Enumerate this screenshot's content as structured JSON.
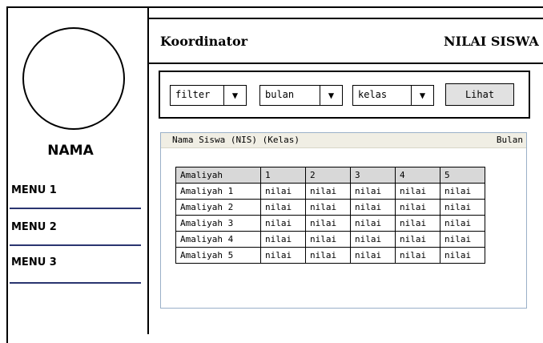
{
  "profile": {
    "name": "NAMA"
  },
  "menu": [
    {
      "label": "MENU 1"
    },
    {
      "label": "MENU 2"
    },
    {
      "label": "MENU 3"
    }
  ],
  "header": {
    "role": "Koordinator",
    "title": "NILAI SISWA"
  },
  "filters": {
    "filter": "filter",
    "bulan": "bulan",
    "kelas": "kelas",
    "button": "Lihat"
  },
  "panel": {
    "left_label": "Nama Siswa (NIS) (Kelas)",
    "right_label": "Bulan"
  },
  "table": {
    "headers": [
      "Amaliyah",
      "1",
      "2",
      "3",
      "4",
      "5"
    ],
    "rows": [
      [
        "Amaliyah 1",
        "nilai",
        "nilai",
        "nilai",
        "nilai",
        "nilai"
      ],
      [
        "Amaliyah 2",
        "nilai",
        "nilai",
        "nilai",
        "nilai",
        "nilai"
      ],
      [
        "Amaliyah 3",
        "nilai",
        "nilai",
        "nilai",
        "nilai",
        "nilai"
      ],
      [
        "Amaliyah 4",
        "nilai",
        "nilai",
        "nilai",
        "nilai",
        "nilai"
      ],
      [
        "Amaliyah 5",
        "nilai",
        "nilai",
        "nilai",
        "nilai",
        "nilai"
      ]
    ]
  }
}
